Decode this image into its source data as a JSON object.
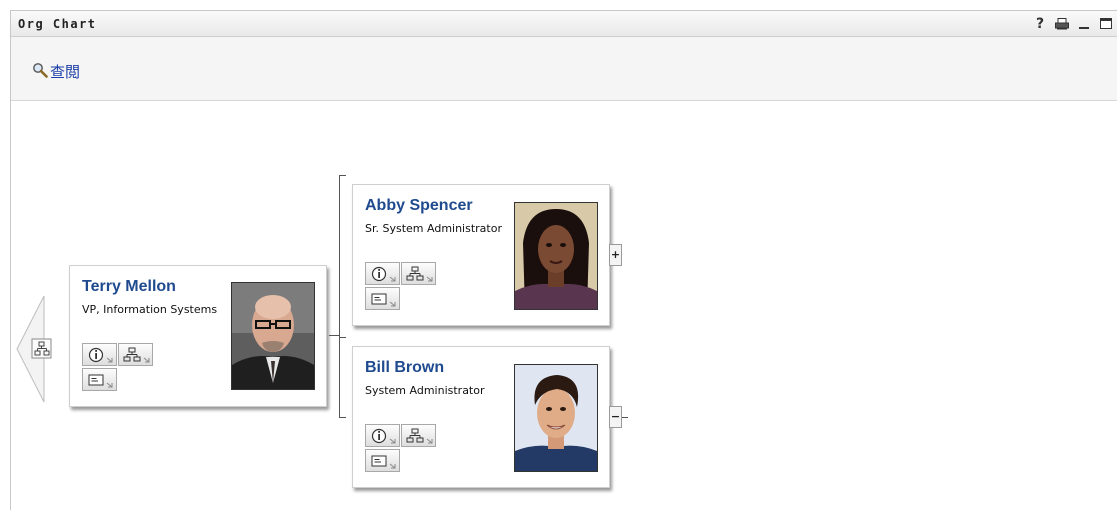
{
  "portlet": {
    "title": "Org Chart",
    "toolbar_icons": [
      "help-icon",
      "print-icon",
      "minimize-icon",
      "maximize-icon"
    ],
    "help_glyph": "?"
  },
  "toolbar": {
    "lookup_label": "查閲",
    "lookup_icon": "magnifier-icon"
  },
  "colors": {
    "name_link": "#1f4a8f",
    "lookup_link": "#1b3fa8"
  },
  "people": {
    "root": {
      "name": "Terry Mellon",
      "title": "VP, Information Systems"
    },
    "reports": [
      {
        "name": "Abby Spencer",
        "title": "Sr. System Administrator",
        "expander": "+"
      },
      {
        "name": "Bill Brown",
        "title": "System Administrator",
        "expander": "−"
      }
    ]
  },
  "card_actions": [
    "info-icon",
    "org-chart-icon",
    "email-icon"
  ]
}
